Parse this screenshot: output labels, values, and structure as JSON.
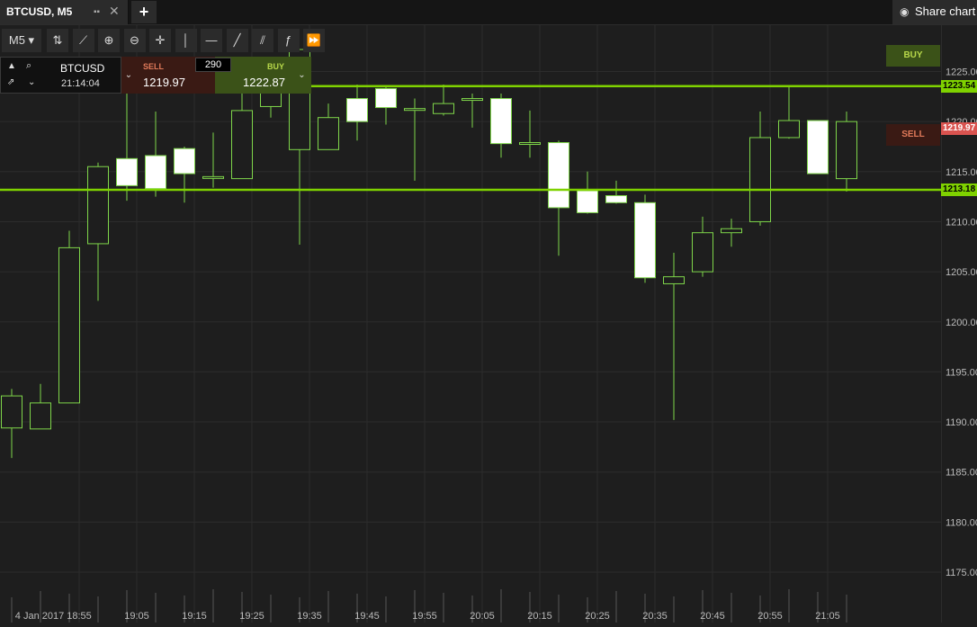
{
  "tab": {
    "title": "BTCUSD, M5",
    "grid_icon": "grid-icon",
    "close_glyph": "✕",
    "new_tab_glyph": "+"
  },
  "share": {
    "label": "Share chart",
    "icon": "camera-icon"
  },
  "toolbar": {
    "timeframe": "M5 ▾",
    "tools": [
      {
        "name": "chart-type-icon",
        "glyph": "⇅"
      },
      {
        "name": "indicators-icon",
        "glyph": "⟋"
      },
      {
        "name": "zoom-in-icon",
        "glyph": "⊕"
      },
      {
        "name": "zoom-out-icon",
        "glyph": "⊖"
      },
      {
        "name": "crosshair-icon",
        "glyph": "✛"
      },
      {
        "name": "vertical-line-icon",
        "glyph": "│"
      },
      {
        "name": "horizontal-line-icon",
        "glyph": "—"
      },
      {
        "name": "trend-line-icon",
        "glyph": "╱"
      },
      {
        "name": "fibonacci-icon",
        "glyph": "⫽"
      },
      {
        "name": "function-icon",
        "glyph": "ƒ"
      },
      {
        "name": "fast-forward-icon",
        "glyph": "⏩"
      }
    ]
  },
  "trade_panel": {
    "symbol": "BTCUSD",
    "time": "21:14:04",
    "sell_label": "SELL",
    "sell_price": "1219.97",
    "buy_label": "BUY",
    "buy_price": "1222.87",
    "spread": "290"
  },
  "side_buttons": {
    "buy": "BUY",
    "sell": "SELL"
  },
  "price_tags": {
    "top_line": "1223.54",
    "sell": "1219.97",
    "bottom_line": "1213.18"
  },
  "colors": {
    "up": "#000000",
    "down": "#ffffff",
    "wick": "#7fd64a",
    "line": "#7fd200",
    "grid": "#2c2c2c"
  },
  "chart_data": {
    "type": "candlestick",
    "symbol": "BTCUSD",
    "timeframe": "M5",
    "y_range": [
      1172,
      1228
    ],
    "y_ticks": [
      "1225.00",
      "1220.00",
      "1215.00",
      "1210.00",
      "1205.00",
      "1200.00",
      "1195.00",
      "1190.00",
      "1185.00",
      "1180.00",
      "1175.00"
    ],
    "x_ticks": [
      "4 Jan 2017",
      "18:55",
      "19:05",
      "19:15",
      "19:25",
      "19:35",
      "19:45",
      "19:55",
      "20:05",
      "20:15",
      "20:25",
      "20:35",
      "20:45",
      "20:55",
      "21:05"
    ],
    "candles": [
      {
        "o": 1189.4,
        "h": 1193.3,
        "l": 1186.4,
        "c": 1192.6
      },
      {
        "o": 1189.3,
        "h": 1193.8,
        "l": 1189.3,
        "c": 1191.9
      },
      {
        "o": 1191.9,
        "h": 1209.1,
        "l": 1191.9,
        "c": 1207.4
      },
      {
        "o": 1207.8,
        "h": 1215.9,
        "l": 1202.1,
        "c": 1215.5
      },
      {
        "o": 1216.3,
        "h": 1223.2,
        "l": 1212.1,
        "c": 1213.6
      },
      {
        "o": 1216.6,
        "h": 1221.0,
        "l": 1212.5,
        "c": 1213.3
      },
      {
        "o": 1217.3,
        "h": 1217.5,
        "l": 1211.9,
        "c": 1214.8
      },
      {
        "o": 1214.4,
        "h": 1218.9,
        "l": 1213.4,
        "c": 1214.5
      },
      {
        "o": 1214.3,
        "h": 1223.0,
        "l": 1214.3,
        "c": 1221.1
      },
      {
        "o": 1221.5,
        "h": 1224.2,
        "l": 1220.4,
        "c": 1225.9
      },
      {
        "o": 1217.2,
        "h": 1227.2,
        "l": 1207.7,
        "c": 1227.2
      },
      {
        "o": 1217.2,
        "h": 1221.8,
        "l": 1217.2,
        "c": 1220.4
      },
      {
        "o": 1222.3,
        "h": 1223.7,
        "l": 1218.1,
        "c": 1220.0
      },
      {
        "o": 1223.3,
        "h": 1223.6,
        "l": 1219.7,
        "c": 1221.4
      },
      {
        "o": 1221.3,
        "h": 1222.3,
        "l": 1214.1,
        "c": 1221.3
      },
      {
        "o": 1220.8,
        "h": 1223.7,
        "l": 1220.6,
        "c": 1221.8
      },
      {
        "o": 1222.2,
        "h": 1222.8,
        "l": 1219.4,
        "c": 1222.3
      },
      {
        "o": 1222.3,
        "h": 1222.8,
        "l": 1216.4,
        "c": 1217.8
      },
      {
        "o": 1217.9,
        "h": 1221.1,
        "l": 1216.4,
        "c": 1217.9
      },
      {
        "o": 1217.9,
        "h": 1218.1,
        "l": 1206.6,
        "c": 1211.4
      },
      {
        "o": 1213.1,
        "h": 1215.0,
        "l": 1210.8,
        "c": 1210.9
      },
      {
        "o": 1212.6,
        "h": 1214.1,
        "l": 1211.8,
        "c": 1211.9
      },
      {
        "o": 1211.9,
        "h": 1212.7,
        "l": 1203.9,
        "c": 1204.4
      },
      {
        "o": 1203.8,
        "h": 1206.9,
        "l": 1190.2,
        "c": 1204.5
      },
      {
        "o": 1205.0,
        "h": 1210.5,
        "l": 1204.5,
        "c": 1208.9
      },
      {
        "o": 1208.9,
        "h": 1210.3,
        "l": 1207.5,
        "c": 1209.3
      },
      {
        "o": 1210.0,
        "h": 1221.0,
        "l": 1209.6,
        "c": 1218.4
      },
      {
        "o": 1218.4,
        "h": 1223.5,
        "l": 1218.3,
        "c": 1220.1
      },
      {
        "o": 1220.1,
        "h": 1220.1,
        "l": 1214.8,
        "c": 1214.8
      },
      {
        "o": 1214.3,
        "h": 1221.0,
        "l": 1213.0,
        "c": 1220.0
      }
    ],
    "horizontal_lines": [
      1223.54,
      1213.18
    ]
  }
}
